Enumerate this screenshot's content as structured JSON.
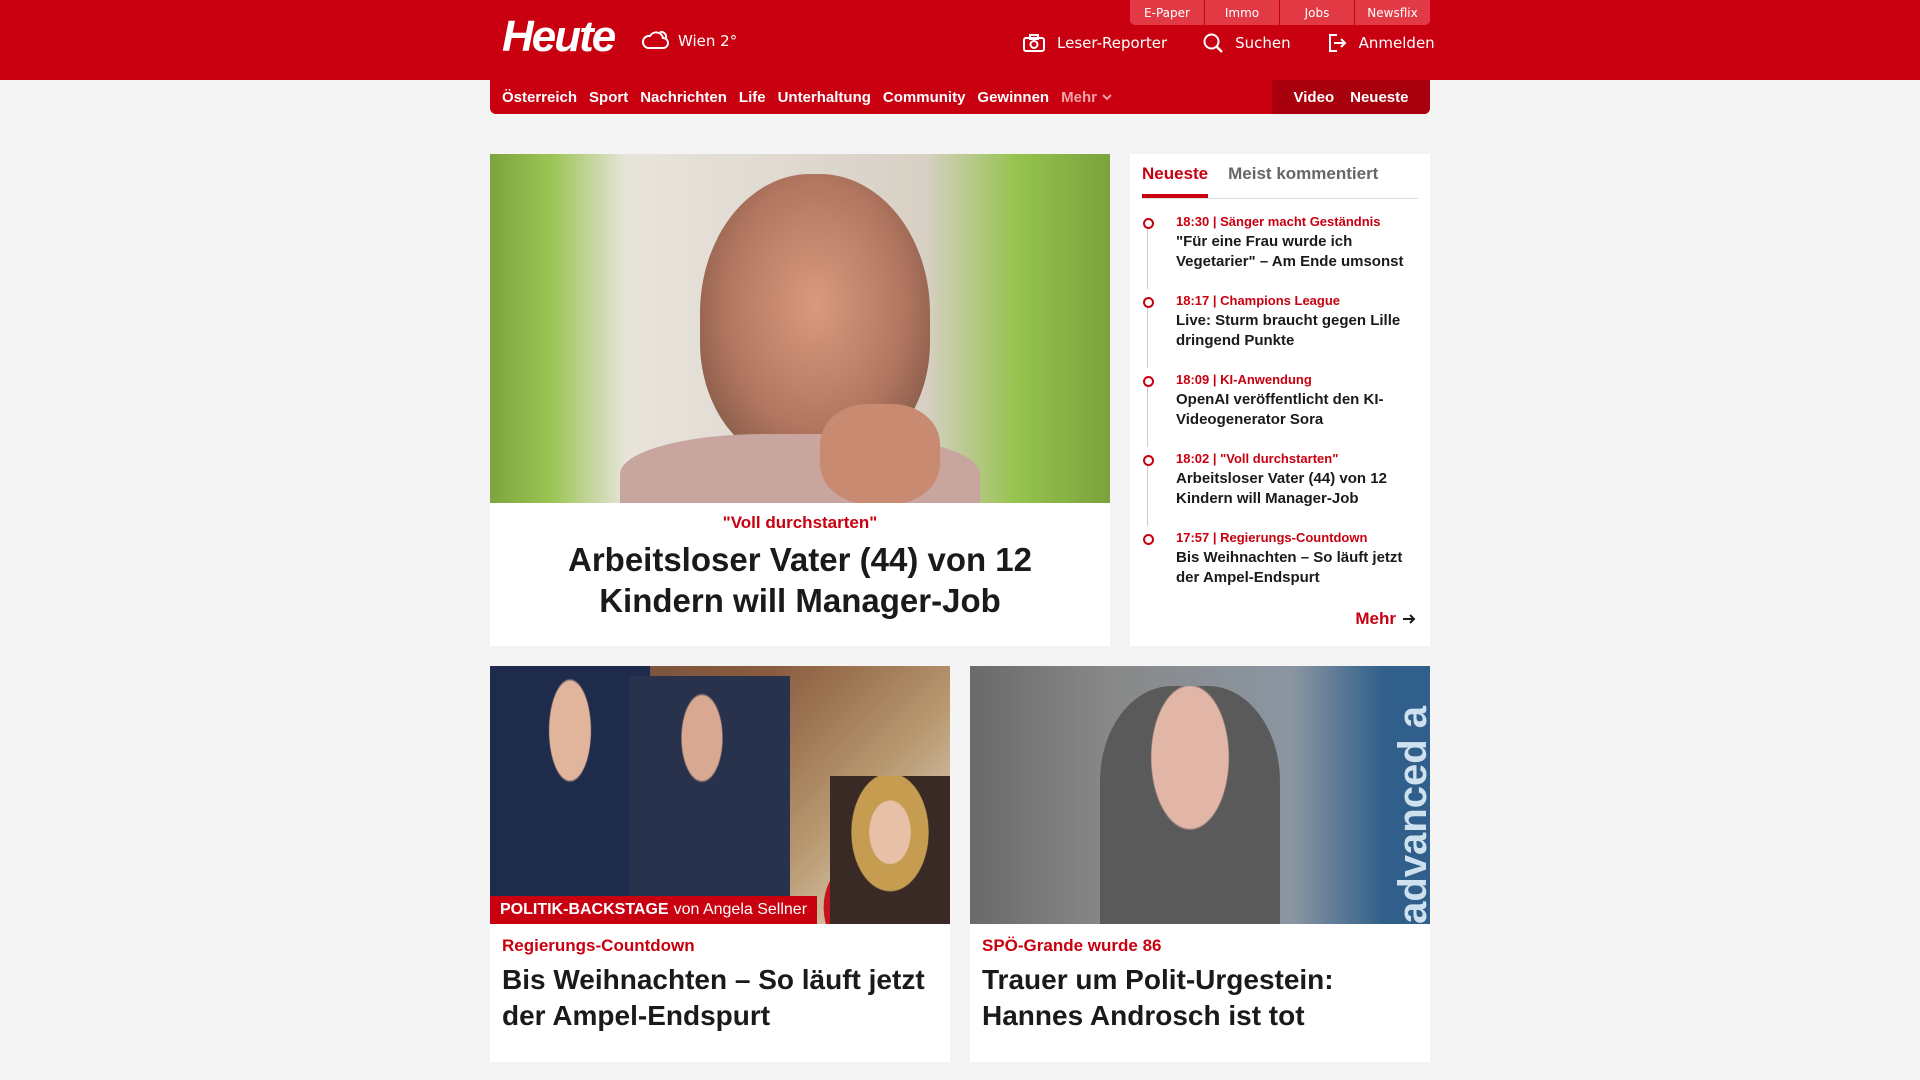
{
  "header": {
    "logo": "Heute",
    "weather": "Wien 2°",
    "util_tabs": [
      "E-Paper",
      "Immo",
      "Jobs",
      "Newsflix"
    ],
    "actions": {
      "reporter": "Leser-Reporter",
      "search": "Suchen",
      "login": "Anmelden"
    },
    "colors": {
      "brand": "#c8000f"
    }
  },
  "nav": {
    "items": [
      "Österreich",
      "Sport",
      "Nachrichten",
      "Life",
      "Unterhaltung",
      "Community",
      "Gewinnen"
    ],
    "more": "Mehr",
    "right": [
      "Video",
      "Neueste"
    ]
  },
  "hero": {
    "kicker": "\"Voll durchstarten\"",
    "title": "Arbeitsloser Vater (44) von 12 Kindern will Manager-Job"
  },
  "sidebar": {
    "tabs": [
      "Neueste",
      "Meist kommentiert"
    ],
    "items": [
      {
        "meta": "18:30 | Sänger macht Geständnis",
        "title": "\"Für eine Frau wurde ich Vegetarier\" – Am Ende umsonst"
      },
      {
        "meta": "18:17 | Champions League",
        "title": "Live: Sturm braucht gegen Lille dringend Punkte"
      },
      {
        "meta": "18:09 | KI-Anwendung",
        "title": "OpenAI veröffentlicht den KI-Videogenerator Sora"
      },
      {
        "meta": "18:02 | \"Voll durchstarten\"",
        "title": "Arbeitsloser Vater (44) von 12 Kindern will Manager-Job"
      },
      {
        "meta": "17:57 | Regierungs-Countdown",
        "title": "Bis Weihnachten – So läuft jetzt der Ampel-Endspurt"
      }
    ],
    "more": "Mehr"
  },
  "cards": [
    {
      "ribbon_bold": "POLITIK-BACKSTAGE",
      "ribbon_rest": "von Angela Sellner",
      "kicker": "Regierungs-Countdown",
      "title": "Bis Weihnachten – So läuft jetzt der Ampel-Endspurt"
    },
    {
      "image_text": "advanced a",
      "kicker": "SPÖ-Grande wurde 86",
      "title": "Trauer um Polit-Urgestein: Hannes Androsch ist tot"
    }
  ]
}
